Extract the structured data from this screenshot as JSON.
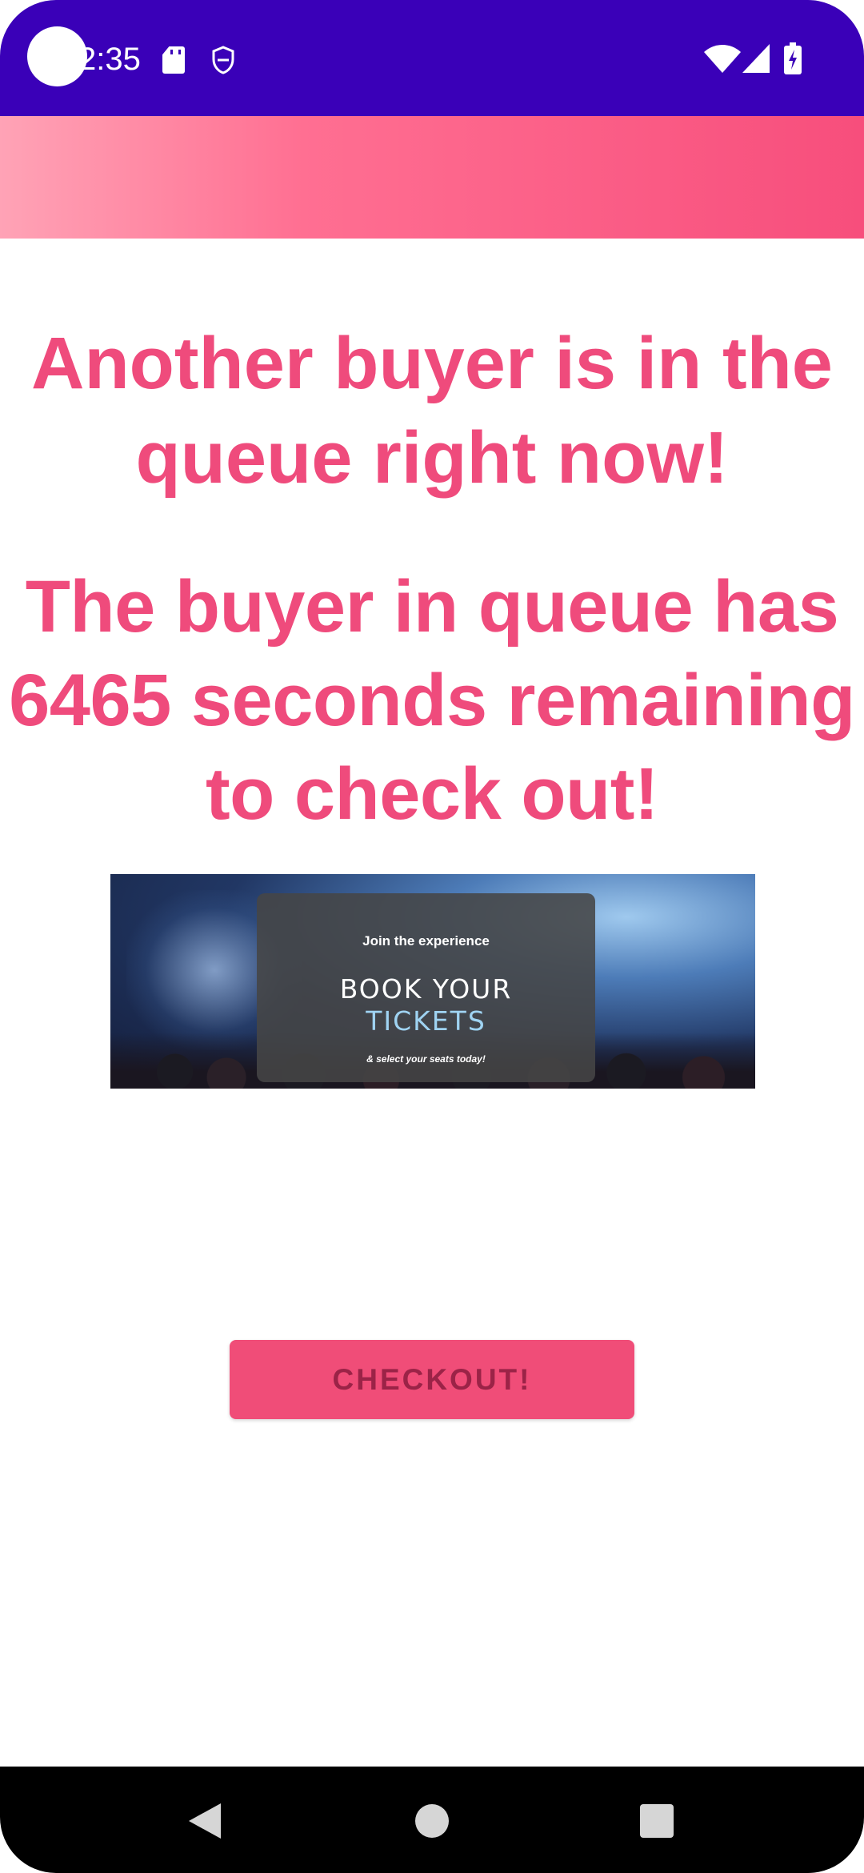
{
  "status_bar": {
    "time": "2:35",
    "icons": [
      "sd-card-icon",
      "shield-icon",
      "wifi-icon",
      "signal-icon",
      "battery-icon"
    ]
  },
  "main": {
    "headline_1": "Another buyer is in the queue right now!",
    "headline_2": "The buyer in queue has 6465 seconds remaining to check out!"
  },
  "banner": {
    "tagline": "Join the experience",
    "title_line_1": "BOOK YOUR",
    "title_line_2": "TICKETS",
    "subtext": "& select your seats today!"
  },
  "checkout": {
    "label": "CHECKOUT!"
  },
  "nav_bar": {
    "icons": [
      "back-icon",
      "home-icon",
      "recents-icon"
    ]
  },
  "colors": {
    "status_bar": "#3a00b8",
    "accent": "#ef4b7c",
    "button": "#f04d78",
    "button_text": "#9b2347"
  }
}
